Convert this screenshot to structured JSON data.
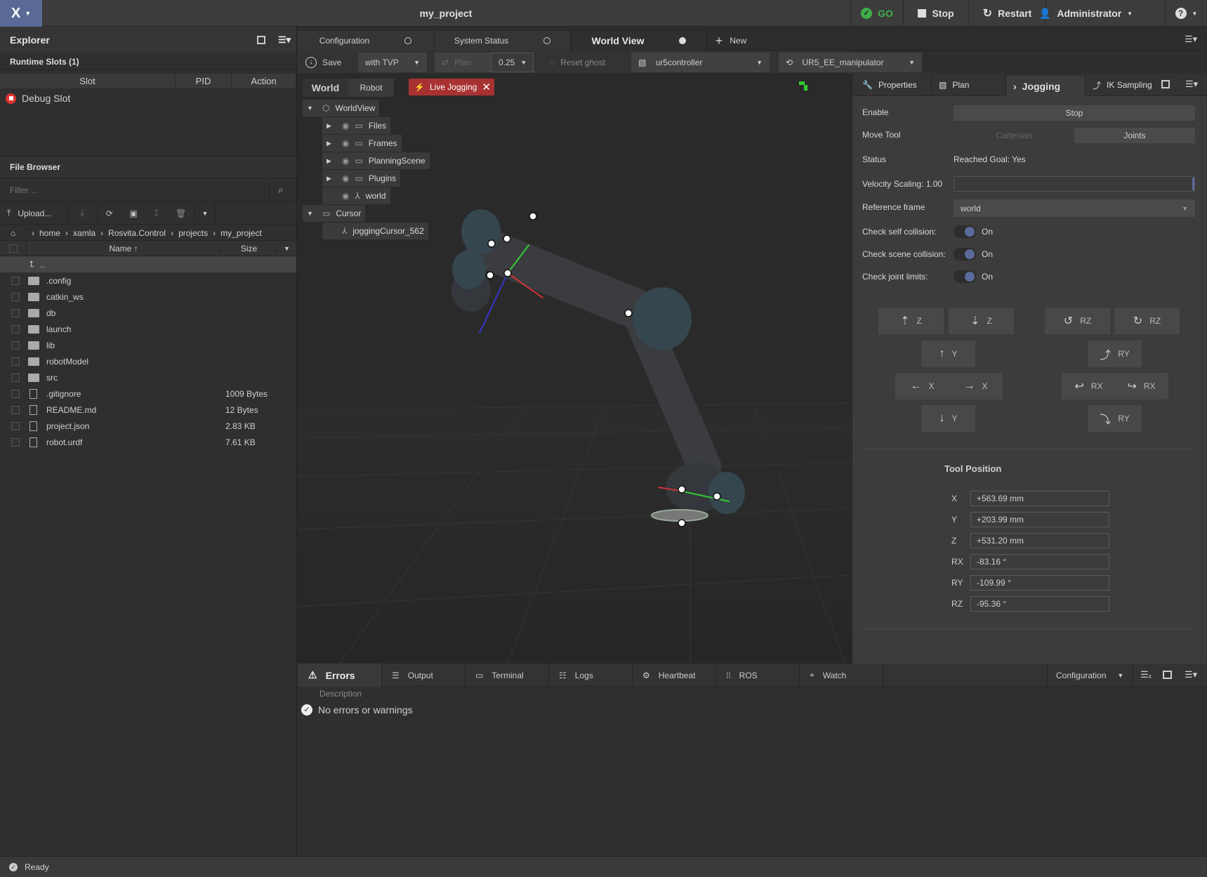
{
  "app": {
    "title": "my_project",
    "logo": "X"
  },
  "topbar": {
    "go": "GO",
    "stop": "Stop",
    "restart": "Restart",
    "user": "Administrator",
    "help": "?",
    "go_color": "#3fae49"
  },
  "explorer": {
    "title": "Explorer",
    "runtime_title": "Runtime Slots (1)",
    "columns": [
      "Slot",
      "PID",
      "Action"
    ],
    "slots": [
      {
        "name": "Debug Slot",
        "pid": "",
        "action": ""
      }
    ]
  },
  "file_browser": {
    "title": "File Browser",
    "filter_placeholder": "Filter ...",
    "upload": "Upload...",
    "breadcrumb": [
      "home",
      "xamla",
      "Rosvita.Control",
      "projects",
      "my_project"
    ],
    "col_name": "Name",
    "col_size": "Size",
    "parent": "..",
    "files": [
      {
        "name": ".config",
        "type": "folder",
        "size": ""
      },
      {
        "name": "catkin_ws",
        "type": "folder",
        "size": ""
      },
      {
        "name": "db",
        "type": "folder",
        "size": ""
      },
      {
        "name": "launch",
        "type": "folder",
        "size": ""
      },
      {
        "name": "lib",
        "type": "folder",
        "size": ""
      },
      {
        "name": "robotModel",
        "type": "folder",
        "size": ""
      },
      {
        "name": "src",
        "type": "folder",
        "size": ""
      },
      {
        "name": ".gitignore",
        "type": "file",
        "size": "1009 Bytes"
      },
      {
        "name": "README.md",
        "type": "file",
        "size": "12 Bytes"
      },
      {
        "name": "project.json",
        "type": "file",
        "size": "2.83 KB"
      },
      {
        "name": "robot.urdf",
        "type": "file",
        "size": "7.61 KB"
      }
    ]
  },
  "doc_tabs": [
    {
      "label": "Configuration"
    },
    {
      "label": "System Status"
    },
    {
      "label": "World View",
      "active": true
    }
  ],
  "new_tab": "New",
  "toolbar": {
    "save": "Save",
    "trajectory": "with TVP",
    "plan": "Plan",
    "plan_value": "0.25",
    "reset_ghost": "Reset ghost",
    "controller": "ur5controller",
    "group": "UR5_EE_manipulator"
  },
  "viewport": {
    "tabs": [
      "World",
      "Robot"
    ],
    "live_jogging": "Live Jogging",
    "live_color": "#a83232",
    "tree": [
      {
        "label": "WorldView",
        "level": 0
      },
      {
        "label": "Files",
        "level": 1
      },
      {
        "label": "Frames",
        "level": 1
      },
      {
        "label": "PlanningScene",
        "level": 1
      },
      {
        "label": "Plugins",
        "level": 1
      },
      {
        "label": "world",
        "level": 1
      },
      {
        "label": "Cursor",
        "level": 0
      },
      {
        "label": "joggingCursor_562",
        "level": 1
      }
    ]
  },
  "right": {
    "tabs": [
      "Properties",
      "Plan",
      "Jogging",
      "IK Sampling"
    ],
    "active_tab": "Jogging",
    "enable_label": "Enable",
    "enable_btn": "Stop",
    "move_tool_label": "Move Tool",
    "cartesian": "Cartesian",
    "joints": "Joints",
    "status_label": "Status",
    "status_value": "Reached Goal: Yes",
    "velocity_label": "Velocity Scaling: 1.00",
    "velocity_value": 1.0,
    "ref_label": "Reference frame",
    "ref_value": "world",
    "checks": [
      {
        "label": "Check self collision:",
        "state": "On"
      },
      {
        "label": "Check scene collision:",
        "state": "On"
      },
      {
        "label": "Check joint limits:",
        "state": "On"
      }
    ],
    "jog": {
      "z_up": "Z",
      "z_down": "Z",
      "y_up": "Y",
      "x_left": "X",
      "x_right": "X",
      "y_down": "Y",
      "rz_ccw": "RZ",
      "rz_cw": "RZ",
      "ry_up": "RY",
      "rx_left": "RX",
      "rx_right": "RX",
      "ry_down": "RY"
    },
    "tool_position": {
      "title": "Tool Position",
      "rows": [
        {
          "axis": "X",
          "value": "+563.69 mm"
        },
        {
          "axis": "Y",
          "value": "+203.99 mm"
        },
        {
          "axis": "Z",
          "value": "+531.20 mm"
        },
        {
          "axis": "RX",
          "value": "-83.16 °"
        },
        {
          "axis": "RY",
          "value": "-109.99 °"
        },
        {
          "axis": "RZ",
          "value": "-95.36 °"
        }
      ]
    }
  },
  "bottom": {
    "tabs": [
      "Errors",
      "Output",
      "Terminal",
      "Logs",
      "Heartbeat",
      "ROS",
      "Watch"
    ],
    "config": "Configuration",
    "description": "Description",
    "message": "No errors or warnings"
  },
  "status": {
    "text": "Ready"
  }
}
